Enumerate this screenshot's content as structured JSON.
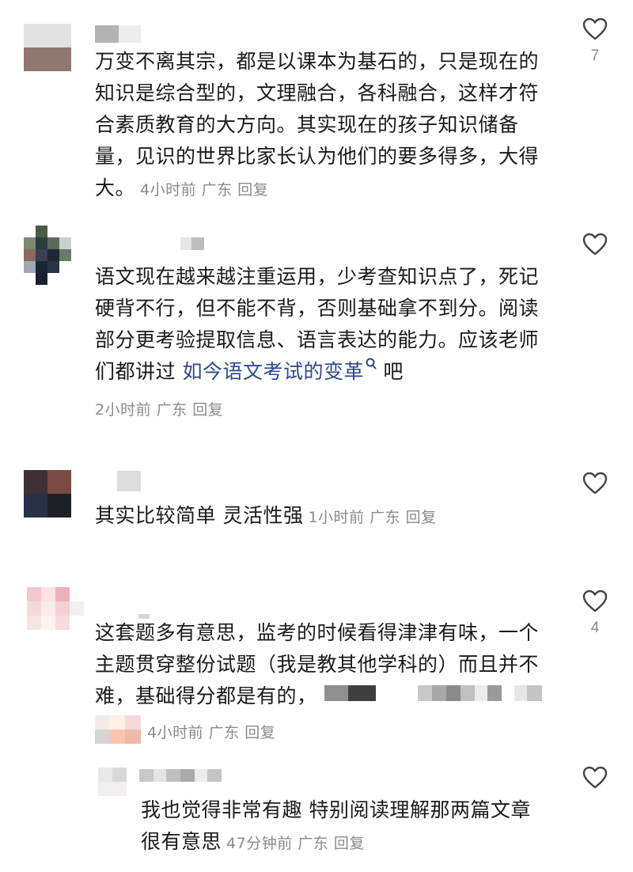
{
  "comments": [
    {
      "text": "万变不离其宗，都是以课本为基石的，只是现在的知识是综合型的，文理融合，各科融合，这样才符合素质教育的大方向。其实现在的孩子知识储备量，见识的世界比家长认为他们的要多得多，大得大。",
      "time": "4小时前",
      "location": "广东",
      "reply": "回复",
      "likes": "7"
    },
    {
      "text_before": "语文现在越来越注重运用，少考查知识点了，死记硬背不行，但不能不背，否则基础拿不到分。阅读部分更考验提取信息、语言表达的能力。应该老师们都讲过 ",
      "link": "如今语文考试的变革",
      "text_after": " 吧",
      "time": "2小时前",
      "location": "广东",
      "reply": "回复",
      "likes": ""
    },
    {
      "text": "其实比较简单 灵活性强",
      "time": "1小时前",
      "location": "广东",
      "reply": "回复",
      "likes": ""
    },
    {
      "text": "这套题多有意思，监考的时候看得津津有味，一个主题贯穿整份试题（我是教其他学科的）而且并不难，基础得分都是有的，",
      "time": "4小时前",
      "location": "广东",
      "reply": "回复",
      "likes": "4"
    }
  ],
  "reply": {
    "text": "我也觉得非常有趣 特别阅读理解那两篇文章很有意思",
    "time": "47分钟前",
    "location": "广东",
    "reply": "回复",
    "likes": ""
  },
  "colors": {
    "text": "#1a1a1a",
    "meta": "#8a8a8a",
    "link": "#2b4a8b",
    "icon": "#444444"
  },
  "icons": {
    "like": "heart-outline-icon",
    "search": "search-icon"
  }
}
